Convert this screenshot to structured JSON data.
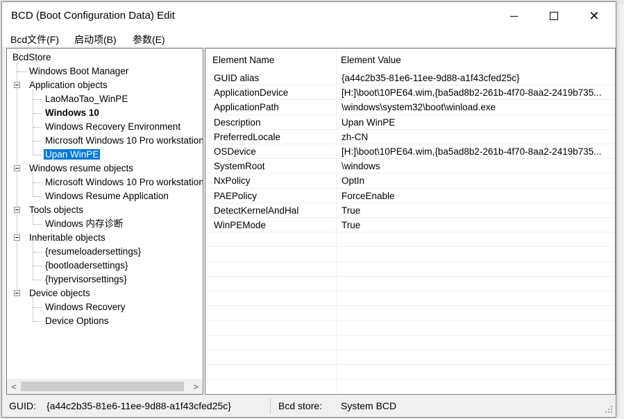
{
  "window": {
    "title": "BCD (Boot Configuration Data) Edit",
    "controls": {
      "minimize": "",
      "maximize": "",
      "close": "✕"
    }
  },
  "menu": [
    "Bcd文件(F)",
    "启动项(B)",
    "参数(E)"
  ],
  "tree": {
    "root": "BcdStore",
    "nodes": [
      {
        "label": "Windows Boot Manager",
        "level": 1,
        "expander": false
      },
      {
        "label": "Application objects",
        "level": 1,
        "expander": true
      },
      {
        "label": "LaoMaoTao_WinPE",
        "level": 2
      },
      {
        "label": "Windows 10",
        "level": 2,
        "bold": true
      },
      {
        "label": "Windows Recovery Environment",
        "level": 2
      },
      {
        "label": "Microsoft Windows 10 Pro workstation",
        "level": 2
      },
      {
        "label": "Upan WinPE",
        "level": 2,
        "selected": true
      },
      {
        "label": "Windows resume objects",
        "level": 1,
        "expander": true
      },
      {
        "label": "Microsoft Windows 10 Pro workstation",
        "level": 2
      },
      {
        "label": "Windows Resume Application",
        "level": 2
      },
      {
        "label": "Tools objects",
        "level": 1,
        "expander": true
      },
      {
        "label": "Windows 内存诊断",
        "level": 2
      },
      {
        "label": "Inheritable objects",
        "level": 1,
        "expander": true
      },
      {
        "label": "{resumeloadersettings}",
        "level": 2
      },
      {
        "label": "{bootloadersettings}",
        "level": 2
      },
      {
        "label": "{hypervisorsettings}",
        "level": 2
      },
      {
        "label": "Device objects",
        "level": 1,
        "expander": true
      },
      {
        "label": "Windows Recovery",
        "level": 2
      },
      {
        "label": "Device Options",
        "level": 2
      }
    ],
    "scroll": {
      "left": "<",
      "right": ">"
    }
  },
  "table": {
    "columns": [
      "Element Name",
      "Element Value"
    ],
    "rows": [
      {
        "name": "GUID alias",
        "value": "{a44c2b35-81e6-11ee-9d88-a1f43cfed25c}"
      },
      {
        "name": "ApplicationDevice",
        "value": "[H:]\\boot\\10PE64.wim,{ba5ad8b2-261b-4f70-8aa2-2419b735..."
      },
      {
        "name": "ApplicationPath",
        "value": "\\windows\\system32\\boot\\winload.exe"
      },
      {
        "name": "Description",
        "value": "Upan WinPE"
      },
      {
        "name": "PreferredLocale",
        "value": "zh-CN"
      },
      {
        "name": "OSDevice",
        "value": "[H:]\\boot\\10PE64.wim,{ba5ad8b2-261b-4f70-8aa2-2419b735..."
      },
      {
        "name": "SystemRoot",
        "value": "\\windows"
      },
      {
        "name": "NxPolicy",
        "value": "OptIn"
      },
      {
        "name": "PAEPolicy",
        "value": "ForceEnable"
      },
      {
        "name": "DetectKernelAndHal",
        "value": "True"
      },
      {
        "name": "WinPEMode",
        "value": "True"
      }
    ],
    "empty_rows": 10
  },
  "status": {
    "guid_label": "GUID:",
    "guid_value": "{a44c2b35-81e6-11ee-9d88-a1f43cfed25c}",
    "store_label": "Bcd store:",
    "store_value": "System BCD"
  },
  "colors": {
    "selection": "#0078d7",
    "border": "#7a7a7a"
  }
}
